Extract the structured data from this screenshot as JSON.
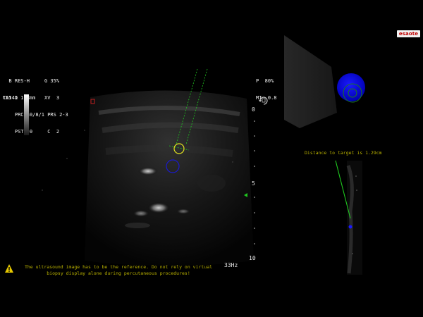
{
  "brand": {
    "logo_text": "esaote"
  },
  "left_params": {
    "line1": "  B RES-H     G 35%",
    "line2": "TEI D 108mm   XV  3",
    "line3": "    PRC 10/8/1 PRS 2-3",
    "line4": "    PST  0     C  2"
  },
  "right_params": {
    "line1": "P  80%",
    "line2": "MI  0.8"
  },
  "probe": {
    "label": "CA541"
  },
  "depth_scale": {
    "label_0": "0",
    "label_5": "5",
    "label_10": "10"
  },
  "frequency": {
    "label": "33Hz"
  },
  "warning": {
    "text": "The ultrasound image has to be the reference. Do not rely on virtual biopsy display alone during percutaneous procedures!"
  },
  "navigation": {
    "distance_text": "Distance to target is 1.29cm"
  },
  "colors": {
    "needle_guide": "#1fc81f",
    "target_ring": "#e0e020",
    "target_fill": "#0000e0",
    "warning_text": "#b8b000"
  },
  "icons": {
    "warning": "warning-triangle-icon",
    "rotate": "rotate-icon"
  }
}
